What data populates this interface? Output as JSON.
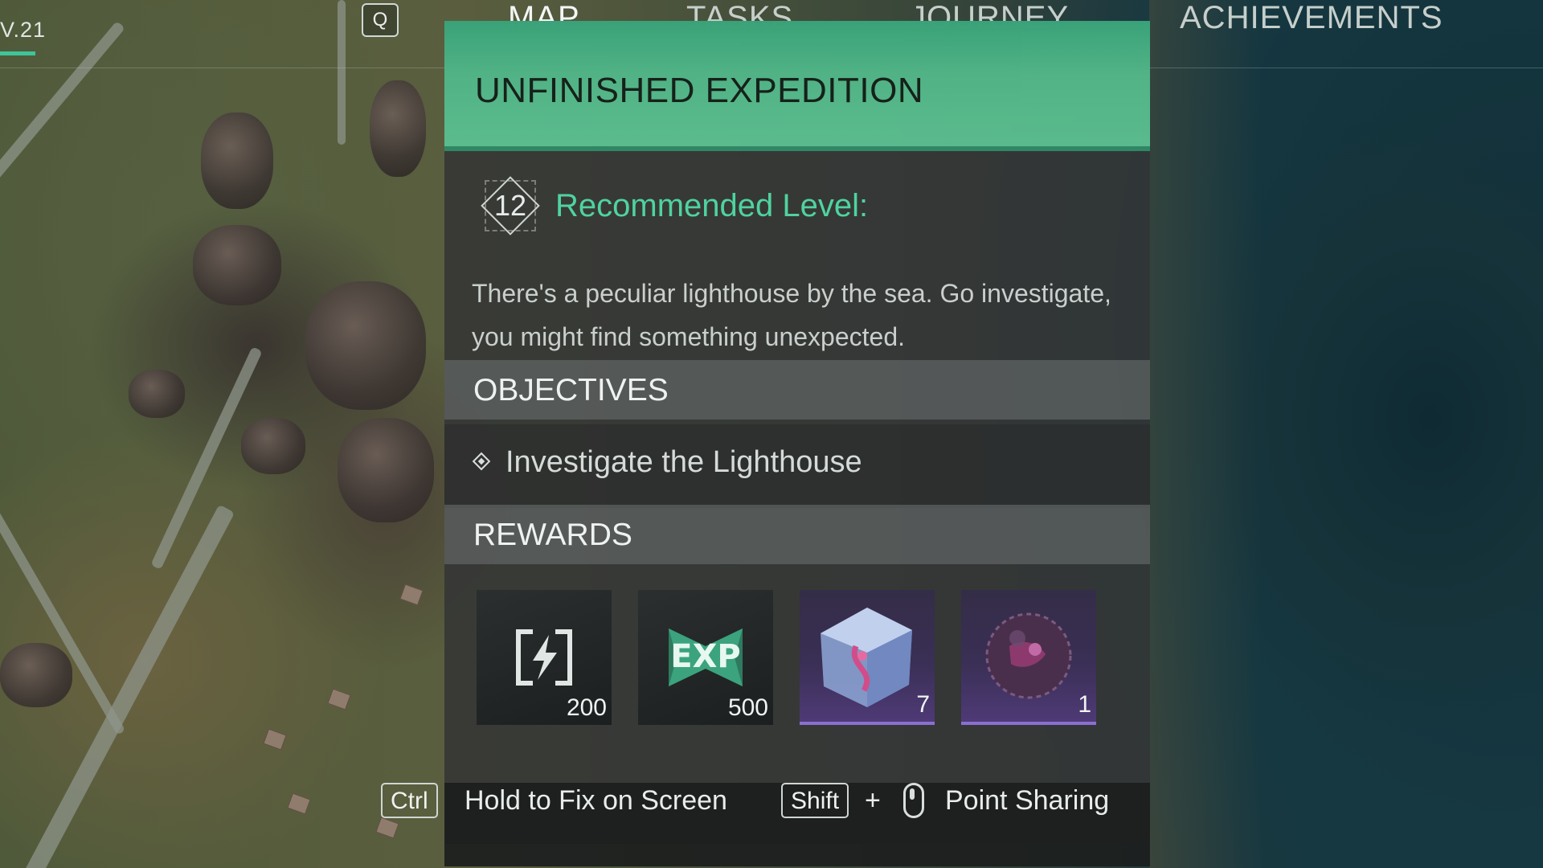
{
  "hud": {
    "version": "V.21",
    "search_key": "Q"
  },
  "tabs": [
    {
      "label": "MAP",
      "active": true
    },
    {
      "label": "TASKS",
      "active": false
    },
    {
      "label": "JOURNEY",
      "active": false
    },
    {
      "label": "ACHIEVEMENTS",
      "active": false
    }
  ],
  "quest": {
    "title": "UNFINISHED EXPEDITION",
    "level": "12",
    "recommended_label": "Recommended Level:",
    "description": "There's a peculiar lighthouse by the sea. Go investigate, you might find something unexpected.",
    "objectives_header": "OBJECTIVES",
    "objectives": [
      "Investigate the Lighthouse"
    ],
    "rewards_header": "REWARDS",
    "rewards": [
      {
        "icon": "energy-icon",
        "count": "200",
        "rarity": "common"
      },
      {
        "icon": "exp-icon",
        "count": "500",
        "rarity": "common"
      },
      {
        "icon": "crystal-cube-icon",
        "count": "7",
        "rarity": "epic"
      },
      {
        "icon": "dark-orb-icon",
        "count": "1",
        "rarity": "epic"
      }
    ]
  },
  "footer": {
    "ctrl_key": "Ctrl",
    "ctrl_hint": "Hold to Fix on Screen",
    "shift_key": "Shift",
    "plus": "+",
    "share_hint": "Point Sharing"
  },
  "colors": {
    "accent": "#4fd3a0",
    "header_green": "#52b98a",
    "epic_purple": "#3a2f55"
  }
}
